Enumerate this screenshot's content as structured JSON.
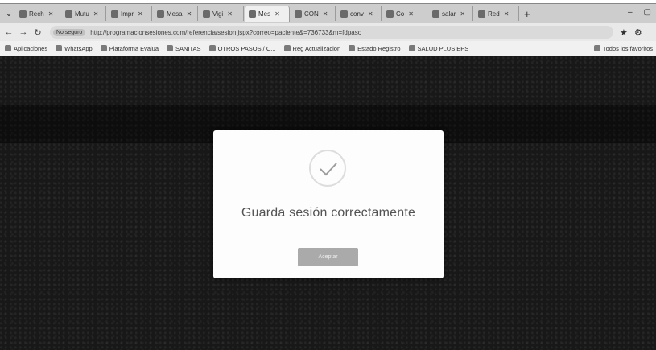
{
  "browser": {
    "tabs": [
      {
        "label": "Rech"
      },
      {
        "label": "Mutu"
      },
      {
        "label": "Impr"
      },
      {
        "label": "Mesa"
      },
      {
        "label": "Vigi"
      },
      {
        "label": "Mes",
        "active": true
      },
      {
        "label": "CON"
      },
      {
        "label": "conv"
      },
      {
        "label": "Co"
      },
      {
        "label": "salar"
      },
      {
        "label": "Red"
      }
    ],
    "address": {
      "security_label": "No seguro",
      "url": "http://programacionsesiones.com/referencia/sesion.jspx?correo=paciente&=736733&m=fdpaso"
    },
    "bookmarks": [
      {
        "label": "Aplicaciones"
      },
      {
        "label": "WhatsApp"
      },
      {
        "label": "Plataforma Evalua"
      },
      {
        "label": "SANITAS"
      },
      {
        "label": "OTROS PASOS / C..."
      },
      {
        "label": "Reg Actualizacion"
      },
      {
        "label": "Estado Registro"
      },
      {
        "label": "SALUD PLUS EPS"
      }
    ],
    "bookmarks_right": "Todos los favoritos"
  },
  "dialog": {
    "icon": "check-icon",
    "message": "Guarda sesión correctamente",
    "ok_label": "Aceptar"
  }
}
